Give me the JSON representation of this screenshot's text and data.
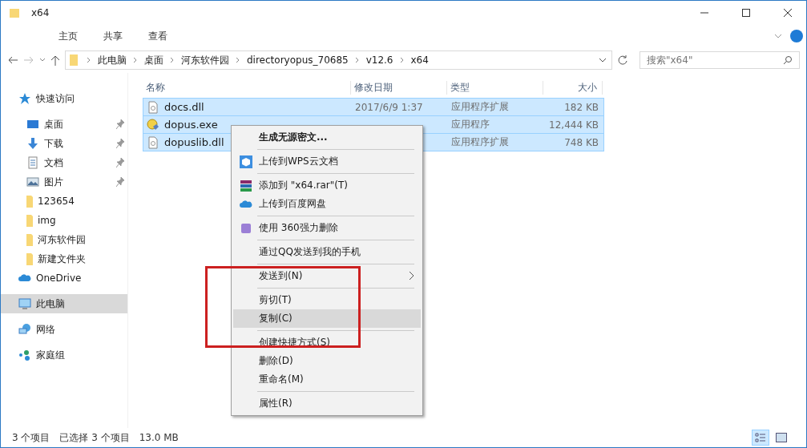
{
  "window": {
    "title": "x64"
  },
  "ribbon_tabs": [
    {
      "label": "主页"
    },
    {
      "label": "共享"
    },
    {
      "label": "查看"
    }
  ],
  "address": {
    "path": [
      "此电脑",
      "桌面",
      "河东软件园",
      "directoryopus_70685",
      "v12.6",
      "x64"
    ]
  },
  "search": {
    "placeholder": "搜索\"x64\""
  },
  "sidebar": {
    "items": [
      {
        "label": "快速访问",
        "pinned": false,
        "selected": false,
        "children": [
          {
            "label": "桌面",
            "pinned": true,
            "selected": false
          },
          {
            "label": "下载",
            "pinned": true,
            "selected": false
          },
          {
            "label": "文档",
            "pinned": true,
            "selected": false
          },
          {
            "label": "图片",
            "pinned": true,
            "selected": false
          },
          {
            "label": "123654",
            "pinned": false,
            "selected": false
          },
          {
            "label": "img",
            "pinned": false,
            "selected": false
          },
          {
            "label": "河东软件园",
            "pinned": false,
            "selected": false
          },
          {
            "label": "新建文件夹",
            "pinned": false,
            "selected": false
          }
        ]
      },
      {
        "label": "OneDrive",
        "pinned": false,
        "selected": false
      },
      {
        "label": "此电脑",
        "pinned": false,
        "selected": true
      },
      {
        "label": "网络",
        "pinned": false,
        "selected": false
      },
      {
        "label": "家庭组",
        "pinned": false,
        "selected": false
      }
    ]
  },
  "table": {
    "columns": [
      "名称",
      "修改日期",
      "类型",
      "大小"
    ],
    "rows": [
      {
        "name": "docs.dll",
        "date": "2017/6/9 1:37",
        "type": "应用程序扩展",
        "size": "182 KB",
        "selected": true
      },
      {
        "name": "dopus.exe",
        "type": "应用程序",
        "size": "12,444 KB",
        "selected": true
      },
      {
        "name": "dopuslib.dll",
        "type": "应用程序扩展",
        "size": "748 KB",
        "selected": true
      }
    ]
  },
  "context_menu": {
    "items": [
      {
        "kind": "item",
        "label": "生成无源密文...",
        "bold": true,
        "highlighted": false
      },
      {
        "kind": "separator"
      },
      {
        "kind": "item",
        "label": "上传到WPS云文档",
        "highlighted": false
      },
      {
        "kind": "separator"
      },
      {
        "kind": "item",
        "label": "添加到 \"x64.rar\"(T)",
        "highlighted": false
      },
      {
        "kind": "item",
        "label": "上传到百度网盘",
        "highlighted": false
      },
      {
        "kind": "separator"
      },
      {
        "kind": "item",
        "label": "使用 360强力删除",
        "highlighted": false
      },
      {
        "kind": "separator"
      },
      {
        "kind": "item",
        "label": "通过QQ发送到我的手机",
        "highlighted": false
      },
      {
        "kind": "separator"
      },
      {
        "kind": "item",
        "label": "发送到(N)",
        "submenu": true,
        "highlighted": false
      },
      {
        "kind": "separator"
      },
      {
        "kind": "item",
        "label": "剪切(T)",
        "highlighted": false
      },
      {
        "kind": "item",
        "label": "复制(C)",
        "highlighted": true
      },
      {
        "kind": "separator"
      },
      {
        "kind": "item",
        "label": "创建快捷方式(S)",
        "highlighted": false
      },
      {
        "kind": "item",
        "label": "删除(D)",
        "highlighted": false
      },
      {
        "kind": "item",
        "label": "重命名(M)",
        "highlighted": false
      },
      {
        "kind": "separator"
      },
      {
        "kind": "item",
        "label": "属性(R)",
        "highlighted": false
      }
    ]
  },
  "annotation": {
    "kind": "rectangle",
    "color": "#cc2020"
  },
  "status_bar": {
    "count": "3 个项目",
    "selection": "已选择 3 个项目",
    "size": "13.0 MB",
    "view_buttons": [
      {
        "selected": true
      },
      {
        "selected": false
      }
    ]
  }
}
